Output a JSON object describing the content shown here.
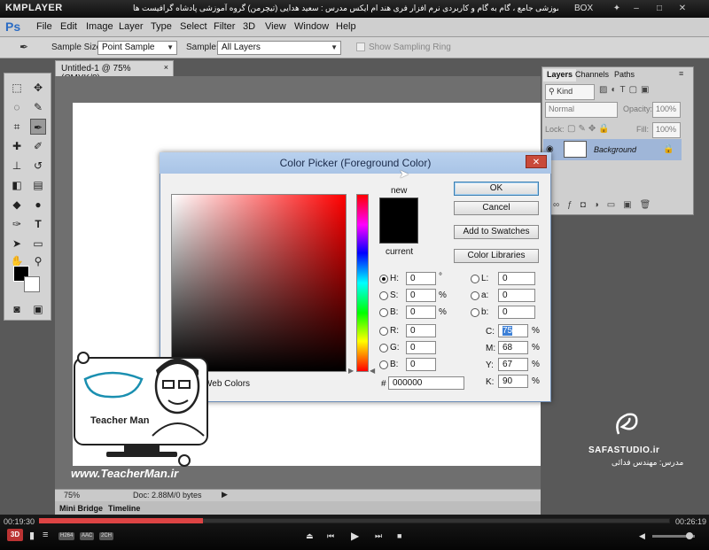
{
  "player": {
    "brand": "KMPLAYER",
    "caption": "مجموعه آموزشی جامع ، گام به گام و کاربردی نرم افزار فری هند ام ایکس   مدرس : سعید هدایی (تیچرمن) گروه آموزشی پادشاه گرافیست ها",
    "box_label": "BOX",
    "time_current": "00:19:30",
    "time_total": "00:26:19",
    "progress": 0.74,
    "badges": [
      "H264",
      "AAC",
      "2CH"
    ],
    "mode_3d": "3D"
  },
  "ps": {
    "logo": "Ps",
    "menu": [
      "File",
      "Edit",
      "Image",
      "Layer",
      "Type",
      "Select",
      "Filter",
      "3D",
      "View",
      "Window",
      "Help"
    ],
    "options": {
      "sample_size_label": "Sample Size:",
      "sample_size_value": "Point Sample",
      "sample_label": "Sample:",
      "sample_value": "All Layers",
      "ring_label": "Show Sampling Ring"
    },
    "doc_tab": "Untitled-1 @ 75% (CMYK/8)",
    "zoom": "75%",
    "doc_info": "Doc: 2.88M/0 bytes",
    "bottom_tabs": [
      "Mini Bridge",
      "Timeline"
    ],
    "layers_panel": {
      "tabs": [
        "Layers",
        "Channels",
        "Paths"
      ],
      "kind": "Kind",
      "blend": "Normal",
      "opacity_label": "Opacity:",
      "opacity": "100%",
      "lock_label": "Lock:",
      "fill_label": "Fill:",
      "fill": "100%",
      "layer_name": "Background"
    }
  },
  "color_picker": {
    "title": "Color Picker (Foreground Color)",
    "new_label": "new",
    "current_label": "current",
    "buttons": {
      "ok": "OK",
      "cancel": "Cancel",
      "add_swatches": "Add to Swatches",
      "libraries": "Color Libraries"
    },
    "web_colors": "Web Colors",
    "hsb": [
      {
        "label": "H:",
        "value": "0",
        "unit": "°"
      },
      {
        "label": "S:",
        "value": "0",
        "unit": "%"
      },
      {
        "label": "B:",
        "value": "0",
        "unit": "%"
      }
    ],
    "rgb": [
      {
        "label": "R:",
        "value": "0"
      },
      {
        "label": "G:",
        "value": "0"
      },
      {
        "label": "B:",
        "value": "0"
      }
    ],
    "lab": [
      {
        "label": "L:",
        "value": "0"
      },
      {
        "label": "a:",
        "value": "0"
      },
      {
        "label": "b:",
        "value": "0"
      }
    ],
    "cmyk": [
      {
        "label": "C:",
        "value": "75",
        "unit": "%"
      },
      {
        "label": "M:",
        "value": "68",
        "unit": "%"
      },
      {
        "label": "Y:",
        "value": "67",
        "unit": "%"
      },
      {
        "label": "K:",
        "value": "90",
        "unit": "%"
      }
    ],
    "hex_label": "#",
    "hex": "000000"
  },
  "overlays": {
    "url": "www.TeacherMan.ir",
    "logo_text": "Teacher Man",
    "studio": "SAFASTUDIO.ir",
    "teacher": "مدرس: مهندس فدائی"
  }
}
